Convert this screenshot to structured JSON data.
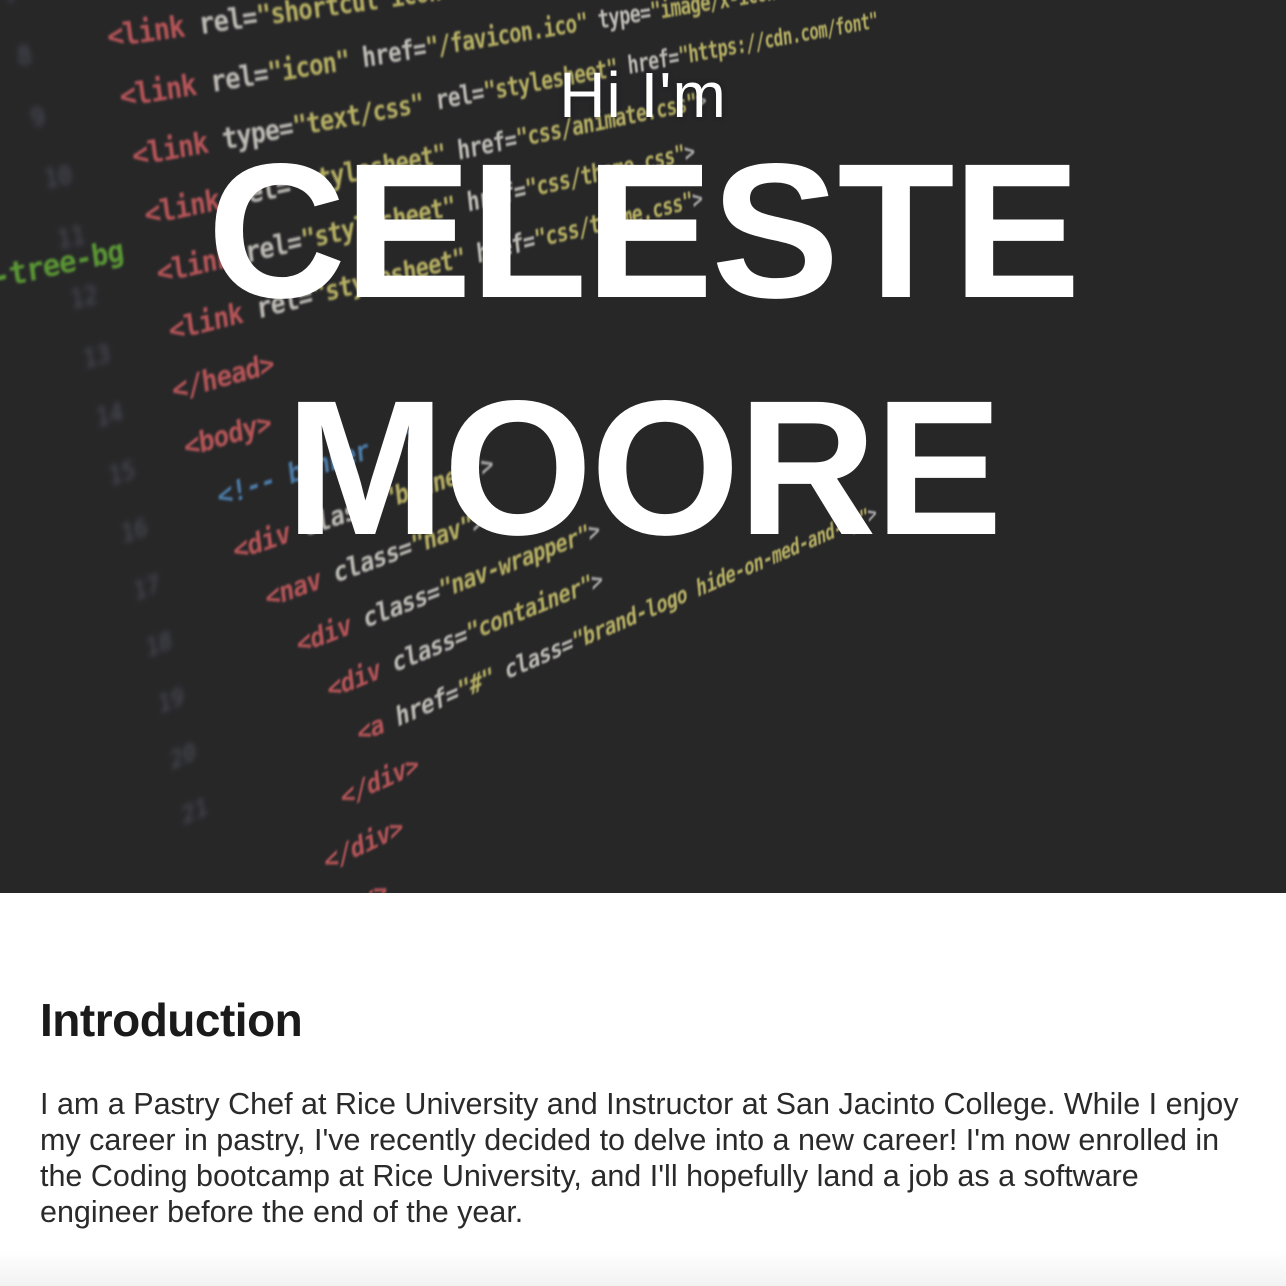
{
  "hero": {
    "greeting": "Hi I'm",
    "first_name": "CELESTE",
    "last_name": "MOORE"
  },
  "introduction": {
    "heading": "Introduction",
    "body": "I am a Pastry Chef at Rice University and Instructor at San Jacinto College. While I enjoy my career in pastry, I've recently decided to delve into a new career! I'm now enrolled in the Coding bootcamp at Rice University, and I'll hopefully land a job as a software engineer before the end of the year."
  },
  "colors": {
    "hero_background": "#2b2b2d",
    "hero_text": "#ffffff",
    "heading_text": "#1a1a1a",
    "body_text": "#2a2a2a"
  }
}
